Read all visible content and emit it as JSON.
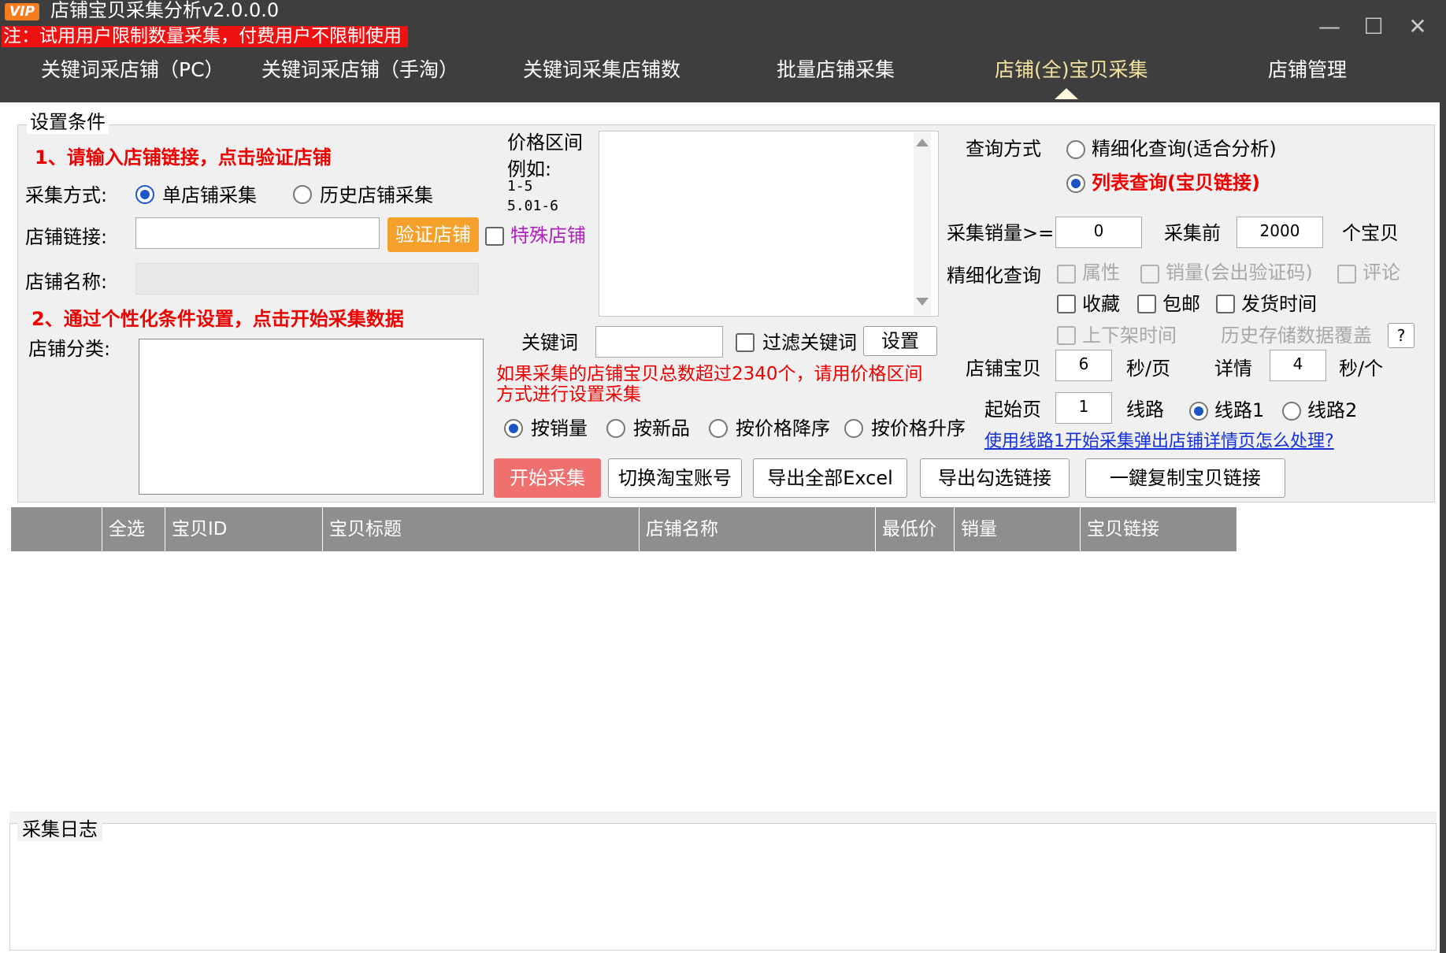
{
  "window": {
    "vip_badge": "VIP",
    "title": "店铺宝贝采集分析v2.0.0.0",
    "notice": "注：试用用户限制数量采集，付费用户不限制使用",
    "minimize": "—",
    "maximize": "☐",
    "close": "✕"
  },
  "tabs": [
    {
      "label": "关键词采店铺（PC）"
    },
    {
      "label": "关键词采店铺（手淘）"
    },
    {
      "label": "关键词采集店铺数"
    },
    {
      "label": "批量店铺采集"
    },
    {
      "label": "店铺(全)宝贝采集"
    },
    {
      "label": "店铺管理"
    }
  ],
  "settings": {
    "group_title": "设置条件",
    "step1": "1、请输入店铺链接，点击验证店铺",
    "collect_mode_label": "采集方式:",
    "mode_single": "单店铺采集",
    "mode_history": "历史店铺采集",
    "shop_link_label": "店铺链接:",
    "shop_link_value": "",
    "verify_button": "验证店铺",
    "special_shop": "特殊店铺",
    "shop_name_label": "店铺名称:",
    "shop_name_value": "",
    "step2": "2、通过个性化条件设置，点击开始采集数据",
    "shop_category_label": "店铺分类:",
    "price_range_label": "价格区间",
    "price_example_label": "例如:",
    "price_example_1": "1-5",
    "price_example_2": "5.01-6",
    "keyword_label": "关键词",
    "keyword_value": "",
    "filter_keyword": "过滤关键词",
    "settings_button": "设置",
    "warning": "如果采集的店铺宝贝总数超过2340个，请用价格区间方式进行设置采集",
    "sort_sales": "按销量",
    "sort_new": "按新品",
    "sort_price_desc": "按价格降序",
    "sort_price_asc": "按价格升序",
    "start_button": "开始采集",
    "switch_account_button": "切换淘宝账号",
    "export_all_button": "导出全部Excel",
    "export_checked_button": "导出勾选链接",
    "copy_links_button": "一鍵复制宝贝链接"
  },
  "query": {
    "method_label": "查询方式",
    "fine_query": "精细化查询(适合分析)",
    "list_query": "列表查询(宝贝链接)",
    "sales_min_label": "采集销量>=",
    "sales_min_value": "0",
    "top_label": "采集前",
    "top_value": "2000",
    "items_unit": "个宝贝",
    "fine_label": "精细化查询",
    "opt_attr": "属性",
    "opt_sales": "销量(会出验证码)",
    "opt_comment": "评论",
    "opt_fav": "收藏",
    "opt_freeship": "包邮",
    "opt_shiptime": "发货时间",
    "opt_onoff": "上下架时间",
    "history_overwrite": "历史存储数据覆盖",
    "help": "?",
    "shop_items_label": "店铺宝贝",
    "shop_items_value": "6",
    "sec_per_page": "秒/页",
    "detail_label": "详情",
    "detail_value": "4",
    "sec_per_item": "秒/个",
    "start_page_label": "起始页",
    "start_page_value": "1",
    "line_label": "线路",
    "line1": "线路1",
    "line2": "线路2",
    "help_link": "使用线路1开始采集弹出店铺详情页怎么处理?"
  },
  "table": {
    "columns": [
      "",
      "全选",
      "宝贝ID",
      "宝贝标题",
      "店铺名称",
      "最低价",
      "销量",
      "宝贝链接"
    ],
    "rows": []
  },
  "log": {
    "title": "采集日志"
  }
}
